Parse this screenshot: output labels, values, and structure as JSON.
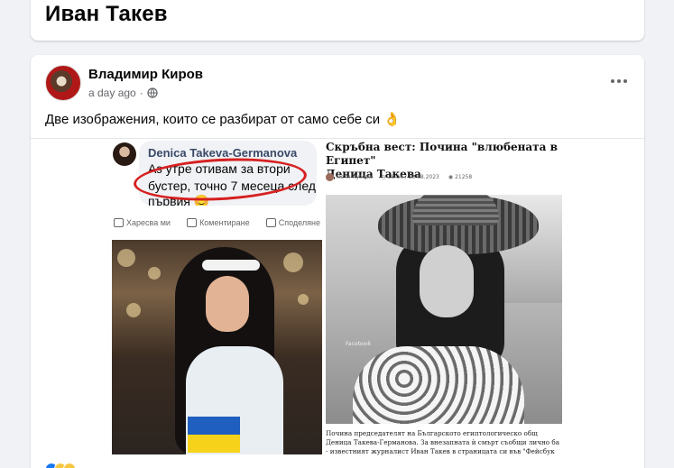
{
  "page": {
    "title": "Иван Такев"
  },
  "post": {
    "author": "Владимир Киров",
    "time": "a day ago",
    "privacy_icon": "globe-icon",
    "more_icon": "more-options-icon",
    "text": "Две изображения, които се разбират от само себе си",
    "text_emoji": "👌"
  },
  "left_image": {
    "commenter": "Denica Takeva-Germanova",
    "comment_lines": [
      "Аз утре отивам за втори",
      "бустер, точно 7 месеца след",
      "първия 😊"
    ],
    "actions": [
      {
        "label": "Харесва ми",
        "icon": "like-icon"
      },
      {
        "label": "Коментиране",
        "icon": "comment-icon"
      },
      {
        "label": "Споделяне",
        "icon": "share-icon"
      }
    ],
    "highlight_color": "#d62020"
  },
  "right_image": {
    "title_lines": [
      "Скръбна вест: Почина \"влюбената в Египет\"",
      "Деница Такева"
    ],
    "author": "Петя Кузева",
    "datetime": "18:04 / 13.08.2023",
    "views": "21258",
    "photo_tag": "Facebook",
    "body_lines": [
      "Почина председателят на Българското египтологическо общ",
      "Деница Такева-Германова. За внезапната ѝ смърт съобщи лично ба",
      "- известният журналист Иван Такев в страницата си във \"Фейсбук"
    ]
  },
  "colors": {
    "background": "#f0f2f5",
    "card": "#ffffff",
    "secondary_text": "#65676b"
  }
}
